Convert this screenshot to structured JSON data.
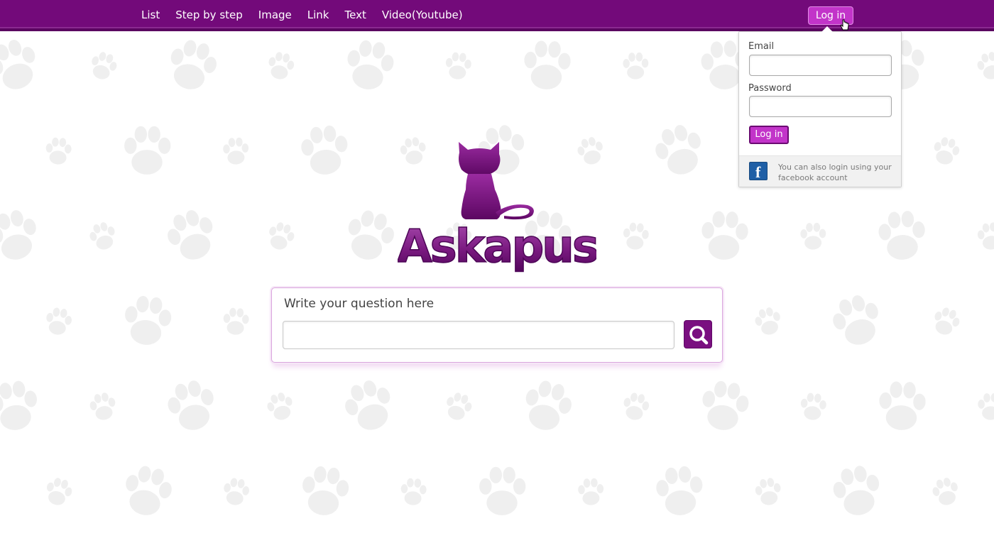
{
  "nav": {
    "links": [
      "List",
      "Step by step",
      "Image",
      "Link",
      "Text",
      "Video(Youtube)"
    ],
    "login_button": "Log in"
  },
  "login_popup": {
    "email_label": "Email",
    "email_value": "",
    "password_label": "Password",
    "password_value": "",
    "submit_label": "Log in",
    "facebook_icon": "facebook-icon",
    "facebook_text": "You can also login using your facebook account"
  },
  "logo": {
    "text": "Askapus",
    "icon": "cat-silhouette-icon"
  },
  "search": {
    "title": "Write your question here",
    "value": "",
    "button_icon": "search-icon"
  },
  "colors": {
    "brand_purple": "#730a7a",
    "button_magenta": "#c234c9",
    "paw_gray": "#eeeeee"
  }
}
